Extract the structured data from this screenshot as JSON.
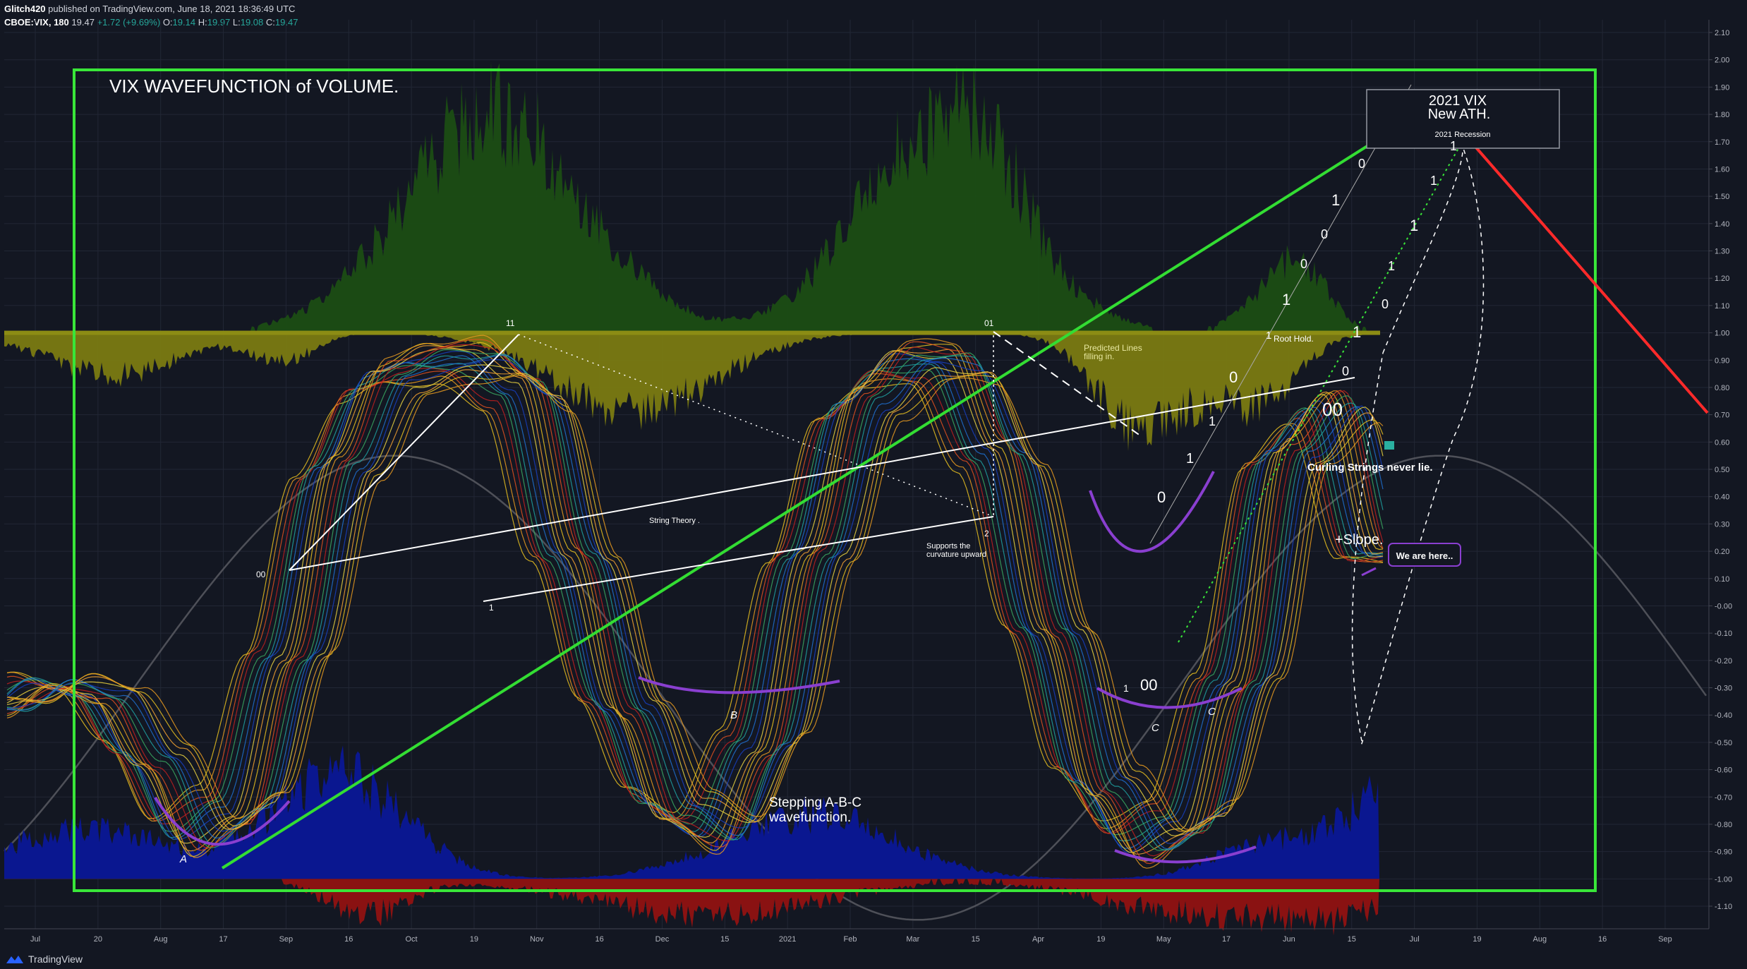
{
  "header": {
    "author": "Glitch420",
    "published": "published on TradingView.com, June 18, 2021 18:36:49 UTC",
    "symbol": "CBOE:VIX, 180",
    "last": "19.47",
    "change": "+1.72 (+9.69%)",
    "o_label": "O:",
    "o_value": "19.14",
    "h_label": "H:",
    "h_value": "19.97",
    "l_label": "L:",
    "l_value": "19.08",
    "c_label": "C:",
    "c_value": "19.47"
  },
  "footer": {
    "brand": "TradingView"
  },
  "colors": {
    "background": "#131722",
    "frame": "#39e639",
    "green_trend": "#33dd33",
    "red_trend": "#ff2a2a",
    "volume_positive": "#1b4d14",
    "volume_negative": "#7a7a12",
    "bottom_blue": "#0a1790",
    "bottom_red": "#8a1212",
    "purple_curve": "#8a3fd0"
  },
  "chart_data": {
    "type": "line",
    "x_ticks": [
      "Jul",
      "20",
      "Aug",
      "17",
      "Sep",
      "16",
      "Oct",
      "19",
      "Nov",
      "16",
      "Dec",
      "15",
      "2021",
      "Feb",
      "Mar",
      "15",
      "Apr",
      "19",
      "May",
      "17",
      "Jun",
      "15",
      "Jul",
      "19",
      "Aug",
      "16",
      "Sep"
    ],
    "y_ticks": [
      "2.10",
      "2.00",
      "1.90",
      "1.80",
      "1.70",
      "1.60",
      "1.50",
      "1.40",
      "1.30",
      "1.20",
      "1.10",
      "1.00",
      "0.90",
      "0.80",
      "0.70",
      "0.60",
      "0.50",
      "0.40",
      "0.30",
      "0.20",
      "0.10",
      "-0.00",
      "-0.10",
      "-0.20",
      "-0.30",
      "-0.40",
      "-0.50",
      "-0.60",
      "-0.70",
      "-0.80",
      "-0.90",
      "-1.00",
      "-1.10"
    ],
    "ylim": [
      -1.1,
      2.1
    ],
    "baseline": 1.0,
    "grid": true,
    "series": [
      {
        "values": [
          -0.4,
          -0.3,
          -0.35,
          -0.6,
          -0.92,
          -0.8,
          -0.2,
          0.55,
          0.9,
          0.97,
          0.98,
          0.85,
          0.2,
          -0.4,
          -0.8,
          -0.9,
          -0.55,
          0.2,
          0.8,
          0.97,
          0.96,
          0.6,
          -0.1,
          -0.7,
          -0.95,
          -0.85,
          -0.3,
          0.6,
          0.8,
          0.2
        ]
      }
    ],
    "annotations": {
      "title": "VIX WAVEFUNCTION of VOLUME.",
      "ath_box_line1": "2021 VIX",
      "ath_box_line2": "New ATH.",
      "ath_box_sub": "2021 Recession",
      "string_theory": "String Theory .",
      "supports_1": "Supports the",
      "supports_2": "curvature upward",
      "predicted_1": "Predicted  Lines",
      "predicted_2": "filling in.",
      "root_hold": "Root Hold.",
      "curling": "Curling Strings never lie.",
      "slope": "+Slope.",
      "we_are_here": "We are here..",
      "stepping_1": "Stepping A-B-C",
      "stepping_2": "wavefunction.",
      "label_A": "A",
      "label_B": "B",
      "label_C1": "C",
      "label_C2": "C",
      "n11": "11",
      "n01": "01",
      "n2": "2",
      "n00_left": "00",
      "n1_left": "1",
      "n00_mid": "00",
      "n1_mid": "1",
      "binary_seq": [
        "1",
        "0",
        "1",
        "1",
        "0",
        "1",
        "0",
        "1",
        "1",
        "0",
        "1",
        "1",
        "0",
        "0",
        "1",
        "00"
      ]
    }
  }
}
